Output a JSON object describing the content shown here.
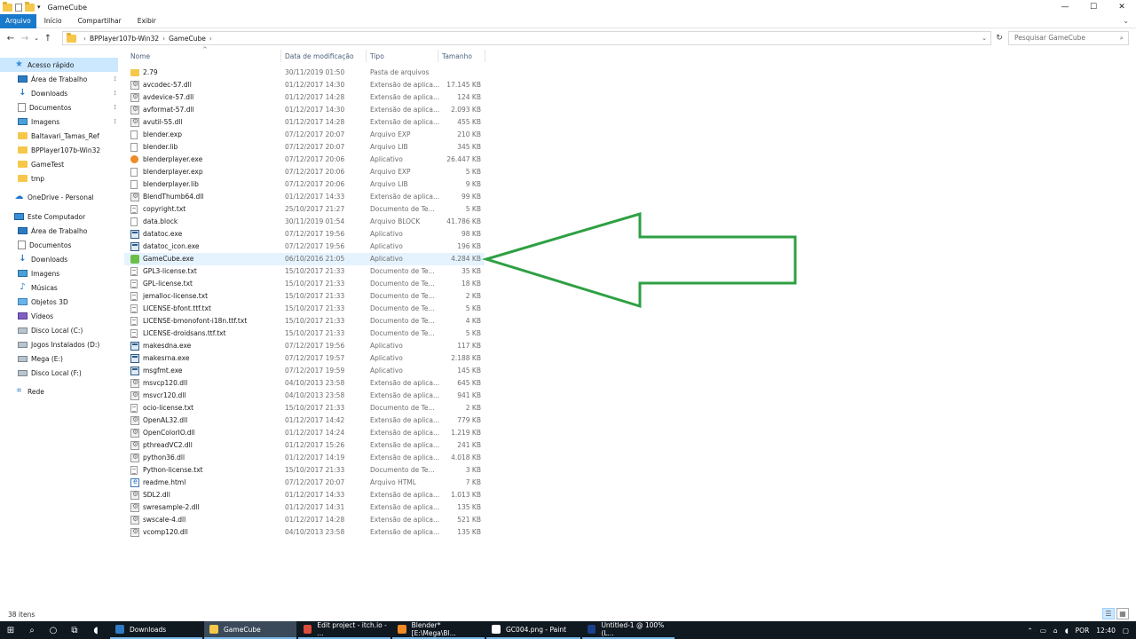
{
  "window": {
    "title": "GameCube",
    "buttons": {
      "minimize": "—",
      "maximize": "☐",
      "close": "✕"
    }
  },
  "ribbon": {
    "tabs": [
      "Arquivo",
      "Início",
      "Compartilhar",
      "Exibir"
    ],
    "expand": "⌄"
  },
  "address": {
    "back": "←",
    "forward": "→",
    "recent": "⌄",
    "up": "↑",
    "crumbs": [
      "BPPlayer107b-Win32",
      "GameCube"
    ],
    "sep": "›",
    "dropdown": "⌄",
    "refresh": "↻",
    "search_placeholder": "Pesquisar GameCube",
    "search_icon": "⌕"
  },
  "nav": {
    "quick_access": "Acesso rápido",
    "quick_items": [
      {
        "label": "Área de Trabalho",
        "icon": "desktop-icon",
        "pinned": true
      },
      {
        "label": "Downloads",
        "icon": "downloads-icon",
        "pinned": true
      },
      {
        "label": "Documentos",
        "icon": "documents-icon",
        "pinned": true
      },
      {
        "label": "Imagens",
        "icon": "pictures-icon",
        "pinned": true
      },
      {
        "label": "Baltavari_Tamas_Ref",
        "icon": "folder-icon",
        "pinned": false
      },
      {
        "label": "BPPlayer107b-Win32",
        "icon": "folder-icon",
        "pinned": false
      },
      {
        "label": "GameTest",
        "icon": "folder-icon",
        "pinned": false
      },
      {
        "label": "tmp",
        "icon": "folder-icon",
        "pinned": false
      }
    ],
    "onedrive": "OneDrive - Personal",
    "this_pc": "Este Computador",
    "pc_items": [
      "Área de Trabalho",
      "Documentos",
      "Downloads",
      "Imagens",
      "Músicas",
      "Objetos 3D",
      "Vídeos",
      "Disco Local (C:)",
      "Jogos Instalados (D:)",
      "Mega (E:)",
      "Disco Local (F:)"
    ],
    "network": "Rede",
    "pin_glyph": "📌"
  },
  "columns": {
    "name": "Nome",
    "date": "Data de modificação",
    "type": "Tipo",
    "size": "Tamanho",
    "sort": "^"
  },
  "files": [
    {
      "name": "2.79",
      "date": "30/11/2019 01:50",
      "type": "Pasta de arquivos",
      "size": "",
      "icon": "folder"
    },
    {
      "name": "avcodec-57.dll",
      "date": "01/12/2017 14:30",
      "type": "Extensão de aplica...",
      "size": "17.145 KB",
      "icon": "gear"
    },
    {
      "name": "avdevice-57.dll",
      "date": "01/12/2017 14:28",
      "type": "Extensão de aplica...",
      "size": "124 KB",
      "icon": "gear"
    },
    {
      "name": "avformat-57.dll",
      "date": "01/12/2017 14:30",
      "type": "Extensão de aplica...",
      "size": "2.093 KB",
      "icon": "gear"
    },
    {
      "name": "avutil-55.dll",
      "date": "01/12/2017 14:28",
      "type": "Extensão de aplica...",
      "size": "455 KB",
      "icon": "gear"
    },
    {
      "name": "blender.exp",
      "date": "07/12/2017 20:07",
      "type": "Arquivo EXP",
      "size": "210 KB",
      "icon": "page"
    },
    {
      "name": "blender.lib",
      "date": "07/12/2017 20:07",
      "type": "Arquivo LIB",
      "size": "345 KB",
      "icon": "page"
    },
    {
      "name": "blenderplayer.exe",
      "date": "07/12/2017 20:06",
      "type": "Aplicativo",
      "size": "26.447 KB",
      "icon": "blender"
    },
    {
      "name": "blenderplayer.exp",
      "date": "07/12/2017 20:06",
      "type": "Arquivo EXP",
      "size": "5 KB",
      "icon": "page"
    },
    {
      "name": "blenderplayer.lib",
      "date": "07/12/2017 20:06",
      "type": "Arquivo LIB",
      "size": "9 KB",
      "icon": "page"
    },
    {
      "name": "BlendThumb64.dll",
      "date": "01/12/2017 14:33",
      "type": "Extensão de aplica...",
      "size": "99 KB",
      "icon": "gear"
    },
    {
      "name": "copyright.txt",
      "date": "25/10/2017 21:27",
      "type": "Documento de Te...",
      "size": "5 KB",
      "icon": "txt"
    },
    {
      "name": "data.block",
      "date": "30/11/2019 01:54",
      "type": "Arquivo BLOCK",
      "size": "41.786 KB",
      "icon": "page"
    },
    {
      "name": "datatoc.exe",
      "date": "07/12/2017 19:56",
      "type": "Aplicativo",
      "size": "98 KB",
      "icon": "exe"
    },
    {
      "name": "datatoc_icon.exe",
      "date": "07/12/2017 19:56",
      "type": "Aplicativo",
      "size": "196 KB",
      "icon": "exe"
    },
    {
      "name": "GameCube.exe",
      "date": "06/10/2016 21:05",
      "type": "Aplicativo",
      "size": "4.284 KB",
      "icon": "gc",
      "highlight": true
    },
    {
      "name": "GPL3-license.txt",
      "date": "15/10/2017 21:33",
      "type": "Documento de Te...",
      "size": "35 KB",
      "icon": "txt"
    },
    {
      "name": "GPL-license.txt",
      "date": "15/10/2017 21:33",
      "type": "Documento de Te...",
      "size": "18 KB",
      "icon": "txt"
    },
    {
      "name": "jemalloc-license.txt",
      "date": "15/10/2017 21:33",
      "type": "Documento de Te...",
      "size": "2 KB",
      "icon": "txt"
    },
    {
      "name": "LICENSE-bfont.ttf.txt",
      "date": "15/10/2017 21:33",
      "type": "Documento de Te...",
      "size": "5 KB",
      "icon": "txt"
    },
    {
      "name": "LICENSE-bmonofont-i18n.ttf.txt",
      "date": "15/10/2017 21:33",
      "type": "Documento de Te...",
      "size": "4 KB",
      "icon": "txt"
    },
    {
      "name": "LICENSE-droidsans.ttf.txt",
      "date": "15/10/2017 21:33",
      "type": "Documento de Te...",
      "size": "5 KB",
      "icon": "txt"
    },
    {
      "name": "makesdna.exe",
      "date": "07/12/2017 19:56",
      "type": "Aplicativo",
      "size": "117 KB",
      "icon": "exe"
    },
    {
      "name": "makesrna.exe",
      "date": "07/12/2017 19:57",
      "type": "Aplicativo",
      "size": "2.188 KB",
      "icon": "exe"
    },
    {
      "name": "msgfmt.exe",
      "date": "07/12/2017 19:59",
      "type": "Aplicativo",
      "size": "145 KB",
      "icon": "exe"
    },
    {
      "name": "msvcp120.dll",
      "date": "04/10/2013 23:58",
      "type": "Extensão de aplica...",
      "size": "645 KB",
      "icon": "gear"
    },
    {
      "name": "msvcr120.dll",
      "date": "04/10/2013 23:58",
      "type": "Extensão de aplica...",
      "size": "941 KB",
      "icon": "gear"
    },
    {
      "name": "ocio-license.txt",
      "date": "15/10/2017 21:33",
      "type": "Documento de Te...",
      "size": "2 KB",
      "icon": "txt"
    },
    {
      "name": "OpenAL32.dll",
      "date": "01/12/2017 14:42",
      "type": "Extensão de aplica...",
      "size": "779 KB",
      "icon": "gear"
    },
    {
      "name": "OpenColorIO.dll",
      "date": "01/12/2017 14:24",
      "type": "Extensão de aplica...",
      "size": "1.219 KB",
      "icon": "gear"
    },
    {
      "name": "pthreadVC2.dll",
      "date": "01/12/2017 15:26",
      "type": "Extensão de aplica...",
      "size": "241 KB",
      "icon": "gear"
    },
    {
      "name": "python36.dll",
      "date": "01/12/2017 14:19",
      "type": "Extensão de aplica...",
      "size": "4.018 KB",
      "icon": "gear"
    },
    {
      "name": "Python-license.txt",
      "date": "15/10/2017 21:33",
      "type": "Documento de Te...",
      "size": "3 KB",
      "icon": "txt"
    },
    {
      "name": "readme.html",
      "date": "07/12/2017 20:07",
      "type": "Arquivo HTML",
      "size": "7 KB",
      "icon": "html"
    },
    {
      "name": "SDL2.dll",
      "date": "01/12/2017 14:33",
      "type": "Extensão de aplica...",
      "size": "1.013 KB",
      "icon": "gear"
    },
    {
      "name": "swresample-2.dll",
      "date": "01/12/2017 14:31",
      "type": "Extensão de aplica...",
      "size": "135 KB",
      "icon": "gear"
    },
    {
      "name": "swscale-4.dll",
      "date": "01/12/2017 14:28",
      "type": "Extensão de aplica...",
      "size": "521 KB",
      "icon": "gear"
    },
    {
      "name": "vcomp120.dll",
      "date": "04/10/2013 23:58",
      "type": "Extensão de aplica...",
      "size": "135 KB",
      "icon": "gear"
    }
  ],
  "status": {
    "count": "38 itens"
  },
  "annotation_color": "#2ea043",
  "taskbar": {
    "apps": [
      {
        "label": "Downloads",
        "color": "#2e7bc4"
      },
      {
        "label": "GameCube",
        "color": "#f5c84c",
        "active": true
      },
      {
        "label": "Edit project - itch.io - ...",
        "color": "#de4c3b"
      },
      {
        "label": "Blender* [E:\\Mega\\Bl...",
        "color": "#f08a24"
      },
      {
        "label": "GC004.png - Paint",
        "color": "#ffffff"
      },
      {
        "label": "Untitled-1 @ 100% (L...",
        "color": "#1c3f8c"
      }
    ],
    "language": "POR",
    "time": "12:40"
  }
}
